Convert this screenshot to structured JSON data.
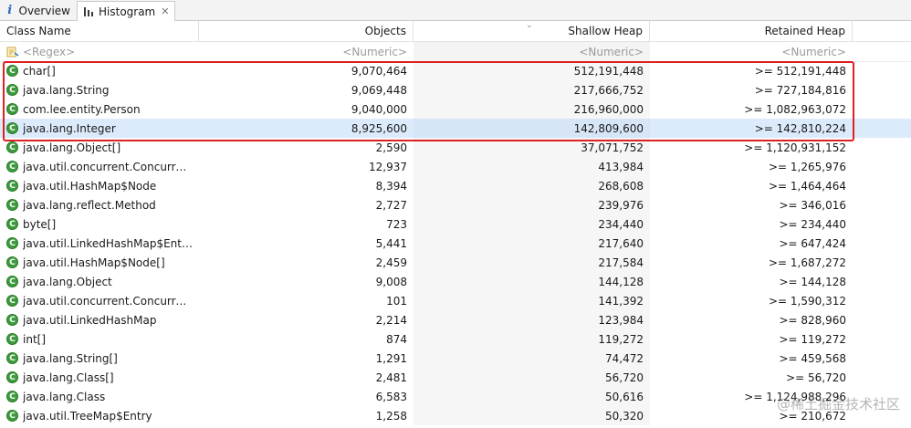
{
  "tabs": [
    {
      "label": "Overview",
      "icon": "info-icon"
    },
    {
      "label": "Histogram",
      "icon": "histogram-icon",
      "close": "✕"
    }
  ],
  "columns": [
    {
      "label": "Class Name"
    },
    {
      "label": "Objects"
    },
    {
      "label": "Shallow Heap"
    },
    {
      "label": "Retained Heap"
    }
  ],
  "filters": {
    "class_name": "<Regex>",
    "objects": "<Numeric>",
    "shallow": "<Numeric>",
    "retained": "<Numeric>"
  },
  "class_icon_letter": "C",
  "rows": [
    {
      "name": "char[]",
      "objects": "9,070,464",
      "shallow": "512,191,448",
      "retained": ">= 512,191,448"
    },
    {
      "name": "java.lang.String",
      "objects": "9,069,448",
      "shallow": "217,666,752",
      "retained": ">= 727,184,816"
    },
    {
      "name": "com.lee.entity.Person",
      "objects": "9,040,000",
      "shallow": "216,960,000",
      "retained": ">= 1,082,963,072"
    },
    {
      "name": "java.lang.Integer",
      "objects": "8,925,600",
      "shallow": "142,809,600",
      "retained": ">= 142,810,224"
    },
    {
      "name": "java.lang.Object[]",
      "objects": "2,590",
      "shallow": "37,071,752",
      "retained": ">= 1,120,931,152"
    },
    {
      "name": "java.util.concurrent.Concurrent...",
      "objects": "12,937",
      "shallow": "413,984",
      "retained": ">= 1,265,976"
    },
    {
      "name": "java.util.HashMap$Node",
      "objects": "8,394",
      "shallow": "268,608",
      "retained": ">= 1,464,464"
    },
    {
      "name": "java.lang.reflect.Method",
      "objects": "2,727",
      "shallow": "239,976",
      "retained": ">= 346,016"
    },
    {
      "name": "byte[]",
      "objects": "723",
      "shallow": "234,440",
      "retained": ">= 234,440"
    },
    {
      "name": "java.util.LinkedHashMap$Entry",
      "objects": "5,441",
      "shallow": "217,640",
      "retained": ">= 647,424"
    },
    {
      "name": "java.util.HashMap$Node[]",
      "objects": "2,459",
      "shallow": "217,584",
      "retained": ">= 1,687,272"
    },
    {
      "name": "java.lang.Object",
      "objects": "9,008",
      "shallow": "144,128",
      "retained": ">= 144,128"
    },
    {
      "name": "java.util.concurrent.Concurrent...",
      "objects": "101",
      "shallow": "141,392",
      "retained": ">= 1,590,312"
    },
    {
      "name": "java.util.LinkedHashMap",
      "objects": "2,214",
      "shallow": "123,984",
      "retained": ">= 828,960"
    },
    {
      "name": "int[]",
      "objects": "874",
      "shallow": "119,272",
      "retained": ">= 119,272"
    },
    {
      "name": "java.lang.String[]",
      "objects": "1,291",
      "shallow": "74,472",
      "retained": ">= 459,568"
    },
    {
      "name": "java.lang.Class[]",
      "objects": "2,481",
      "shallow": "56,720",
      "retained": ">= 56,720"
    },
    {
      "name": "java.lang.Class",
      "objects": "6,583",
      "shallow": "50,616",
      "retained": ">= 1,124,988,296"
    },
    {
      "name": "java.util.TreeMap$Entry",
      "objects": "1,258",
      "shallow": "50,320",
      "retained": ">= 210,672"
    }
  ],
  "selected_row": 3,
  "highlight_color": "#e02020",
  "watermark": "@稀土掘金技术社区"
}
